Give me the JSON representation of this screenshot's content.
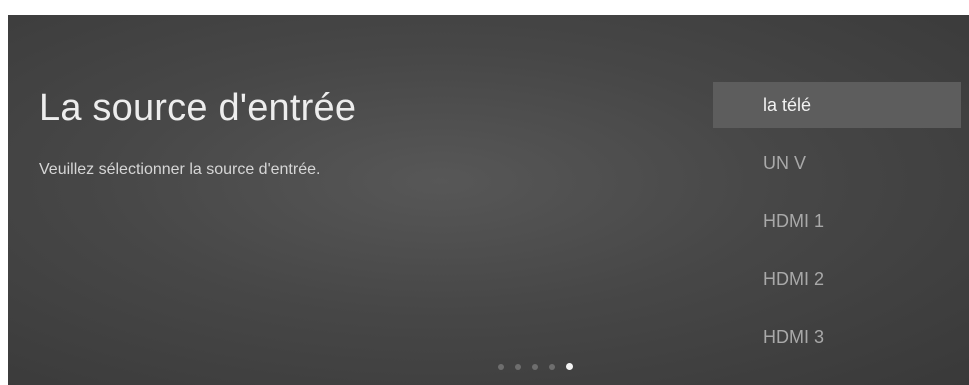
{
  "panel": {
    "title": "La source d'entrée",
    "subtitle": "Veuillez sélectionner la source d'entrée."
  },
  "sources": [
    {
      "label": "la télé",
      "selected": true
    },
    {
      "label": "UN V",
      "selected": false
    },
    {
      "label": "HDMI 1",
      "selected": false
    },
    {
      "label": "HDMI 2",
      "selected": false
    },
    {
      "label": "HDMI 3",
      "selected": false
    }
  ],
  "pager": {
    "count": 5,
    "active_index": 4
  },
  "colors": {
    "background": "#474747",
    "selected_highlight": "#5d5d5d",
    "title_text": "#ededed",
    "item_text": "#a9a9a9",
    "dot_active": "#f4f4f4",
    "dot_inactive": "#6e6e6e"
  }
}
